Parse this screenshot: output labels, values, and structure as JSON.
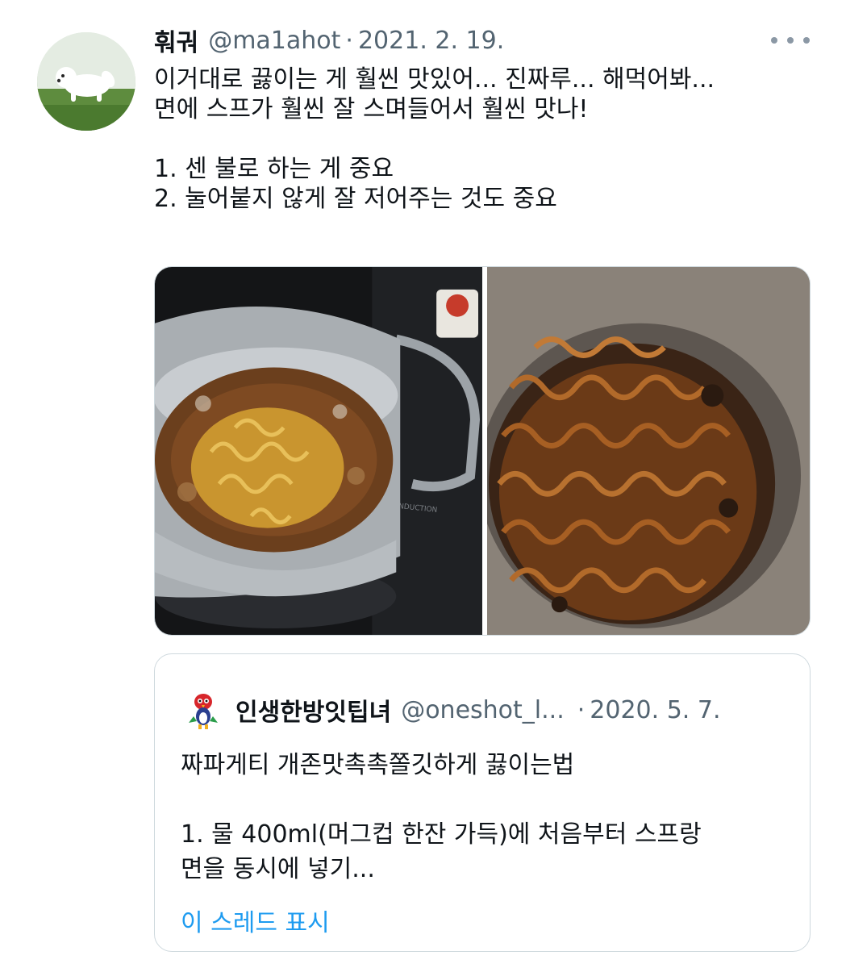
{
  "tweet": {
    "display_name": "훠궈",
    "handle": "@ma1ahot",
    "separator": "·",
    "date": "2021. 2. 19.",
    "text_lines": [
      "이거대로 끓이는 게 훨씬 맛있어... 진짜루... 해먹어봐...",
      "면에 스프가 훨씬 잘 스며들어서 훨씬 맛나!",
      "",
      "1. 센 불로 하는 게 중요",
      "2. 눌어붙지 않게 잘 저어주는 것도 중요"
    ],
    "avatar_icon": "white-puppy-running-on-grass",
    "more_icon": "more-horizontal-icon"
  },
  "media": {
    "photos": [
      {
        "icon": "pot-boiling-noodles-photo",
        "visible_text": "INDUCTION"
      },
      {
        "icon": "pot-cooked-black-bean-noodles-photo"
      }
    ]
  },
  "quoted_tweet": {
    "display_name": "인생한방잇팁녀",
    "handle": "@oneshot_l...",
    "separator": "·",
    "date": "2020. 5. 7.",
    "avatar_icon": "cartoon-bird-mascot",
    "text_lines": [
      "짜파게티 개존맛촉촉쫄깃하게 끓이는법",
      "",
      "1. 물 400ml(머그컵 한잔 가득)에 처음부터 스프랑",
      "면을 동시에 넣기..."
    ],
    "show_thread_label": "이 스레드 표시"
  },
  "colors": {
    "text_primary": "#0f1419",
    "text_secondary": "#536471",
    "link": "#1d9bf0",
    "border": "#cfd9de"
  }
}
